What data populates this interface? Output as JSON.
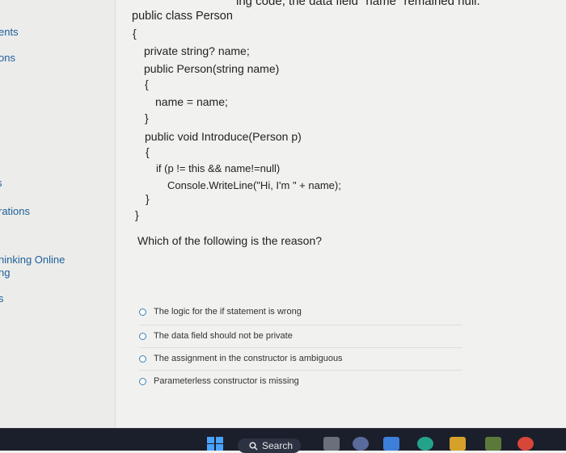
{
  "sidebar": {
    "items": [
      {
        "label": "ents"
      },
      {
        "label": "ons"
      },
      {
        "label": "s"
      },
      {
        "label": "rations"
      },
      {
        "label": "hinking Online"
      },
      {
        "label": "ng"
      },
      {
        "label": "s"
      }
    ]
  },
  "header_fragment": "ing code, the data field \"name\" remained null.",
  "code_lines": [
    "public class Person",
    "{",
    "private string? name;",
    "public Person(string name)",
    "{",
    "name = name;",
    "}",
    "public void Introduce(Person p)",
    "{",
    "if (p != this && name!=null)",
    "Console.WriteLine(\"Hi, I'm \" + name);",
    "}",
    "}"
  ],
  "question": "Which of the following is the reason?",
  "options": [
    "The logic for the if statement is wrong",
    "The data field should not be private",
    "The assignment in the constructor is ambiguous",
    "Parameterless constructor is missing"
  ],
  "taskbar": {
    "search_label": "Search",
    "colors": {
      "bg": "#1b1f2b",
      "windows": "#4aa3ff"
    }
  }
}
